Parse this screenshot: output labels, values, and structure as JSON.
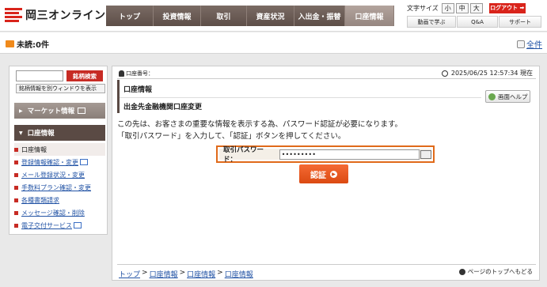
{
  "brand": {
    "name": "岡三オンライン"
  },
  "global_nav": [
    "トップ",
    "投資情報",
    "取引",
    "資産状況",
    "入出金・振替",
    "口座情報"
  ],
  "utility": {
    "font_size_label": "文字サイズ",
    "font_sizes": [
      "小",
      "中",
      "大"
    ],
    "logout": "ログアウト",
    "links": [
      "動画で学ぶ",
      "Q&A",
      "サポート"
    ]
  },
  "message_bar": {
    "unread": "未読:0件",
    "full_view": "全件"
  },
  "sidebar": {
    "search_button": "銘柄検索",
    "new_window": "銘柄情報を別ウィンドウを表示",
    "market_info": "マーケット情報",
    "account_header": "口座情報",
    "items": [
      {
        "label": "口座情報"
      },
      {
        "label": "登録情報確認・変更"
      },
      {
        "label": "メール登録状況・変更"
      },
      {
        "label": "手数料プラン確認・変更"
      },
      {
        "label": "各種書類請求"
      },
      {
        "label": "メッセージ確認・削除"
      },
      {
        "label": "電子交付サービス"
      }
    ]
  },
  "main": {
    "account_number_label": "口座番号：",
    "datetime": "2025/06/25 12:57:34 現在",
    "page_title": "口座情報",
    "page_subtitle": "出金先金融機関口座変更",
    "help_button": "画面ヘルプ",
    "notice_line1": "この先は、お客さまの重要な情報を表示する為、パスワード認証が必要になります。",
    "notice_line2": "「取引パスワード」を入力して、「認証」ボタンを押してください。",
    "password_label": "取引パスワード：",
    "password_value": "•••••••••",
    "auth_button": "認証",
    "breadcrumb": [
      "トップ",
      "口座情報",
      "口座情報",
      "口座情報"
    ],
    "page_top": "ページのトップへもどる"
  },
  "colors": {
    "brand_red": "#d9241b",
    "nav_brown": "#5d4e48",
    "auth_orange": "#e9541a",
    "link_blue": "#2253a5"
  }
}
